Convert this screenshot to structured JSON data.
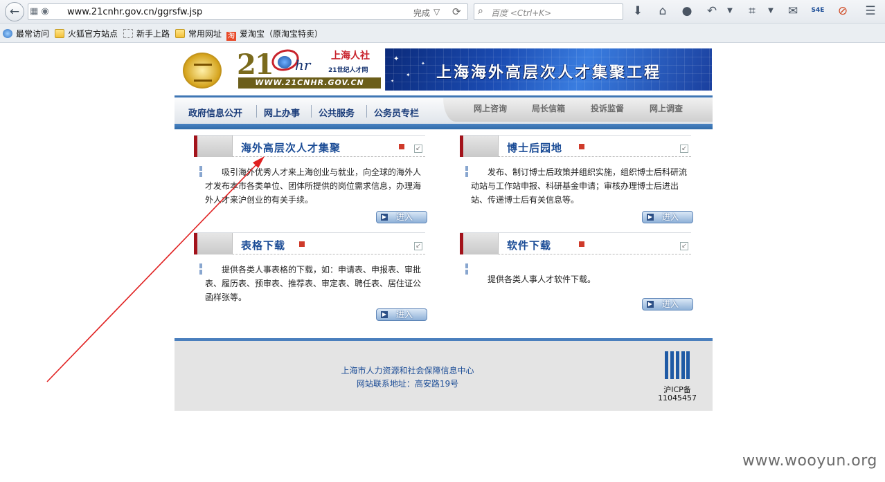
{
  "browser": {
    "url": "www.21cnhr.gov.cn/ggrsfw.jsp",
    "status": "完成",
    "search_placeholder": "百度 <Ctrl+K>",
    "bookmarks": [
      "最常访问",
      "火狐官方站点",
      "新手上路",
      "常用网址",
      "爱淘宝（原淘宝特卖）"
    ],
    "toolbar_icons": [
      "download-icon",
      "home-icon",
      "chat-icon",
      "undo-icon",
      "crop-icon",
      "comment-icon",
      "s4e-icon",
      "block-icon",
      "menu-icon"
    ],
    "s4e_label": "S4E"
  },
  "site": {
    "logo": {
      "number": "21",
      "hr": "hr",
      "cn_name": "上海人社",
      "sub": "21世纪人才网",
      "url": "WWW.21CNHR.GOV.CN"
    },
    "banner_title": "上海海外高层次人才集聚工程",
    "nav_main": [
      "政府信息公开",
      "网上办事",
      "公共服务",
      "公务员专栏"
    ],
    "nav_secondary": [
      "网上咨询",
      "局长信箱",
      "投诉监督",
      "网上调查"
    ],
    "sections": [
      {
        "title": "海外高层次人才集聚",
        "desc": "吸引海外优秀人才来上海创业与就业，向全球的海外人才发布本市各类单位、团体所提供的岗位需求信息，办理海外人才来沪创业的有关手续。",
        "button": "进入"
      },
      {
        "title": "博士后园地",
        "desc": "发布、制订博士后政策并组织实施，组织博士后科研流动站与工作站申报、科研基金申请；审核办理博士后进出站、传递博士后有关信息等。",
        "button": "进入"
      },
      {
        "title": "表格下载",
        "desc": "提供各类人事表格的下载，如：申请表、申报表、审批表、履历表、预审表、推荐表、审定表、聘任表、居住证公函样张等。",
        "button": "进入"
      },
      {
        "title": "软件下载",
        "desc": "提供各类人事人才软件下载。",
        "button": "进入"
      }
    ],
    "footer": {
      "org": "上海市人力资源和社会保障信息中心",
      "address": "网站联系地址：高安路19号",
      "icp_line1": "沪ICP备",
      "icp_line2": "11045457"
    }
  },
  "watermark": "www.wooyun.org",
  "colors": {
    "nav_blue": "#1a3c7a",
    "section_title": "#1b4c96",
    "accent_red": "#a3131b",
    "annotation_arrow": "#e02020"
  }
}
